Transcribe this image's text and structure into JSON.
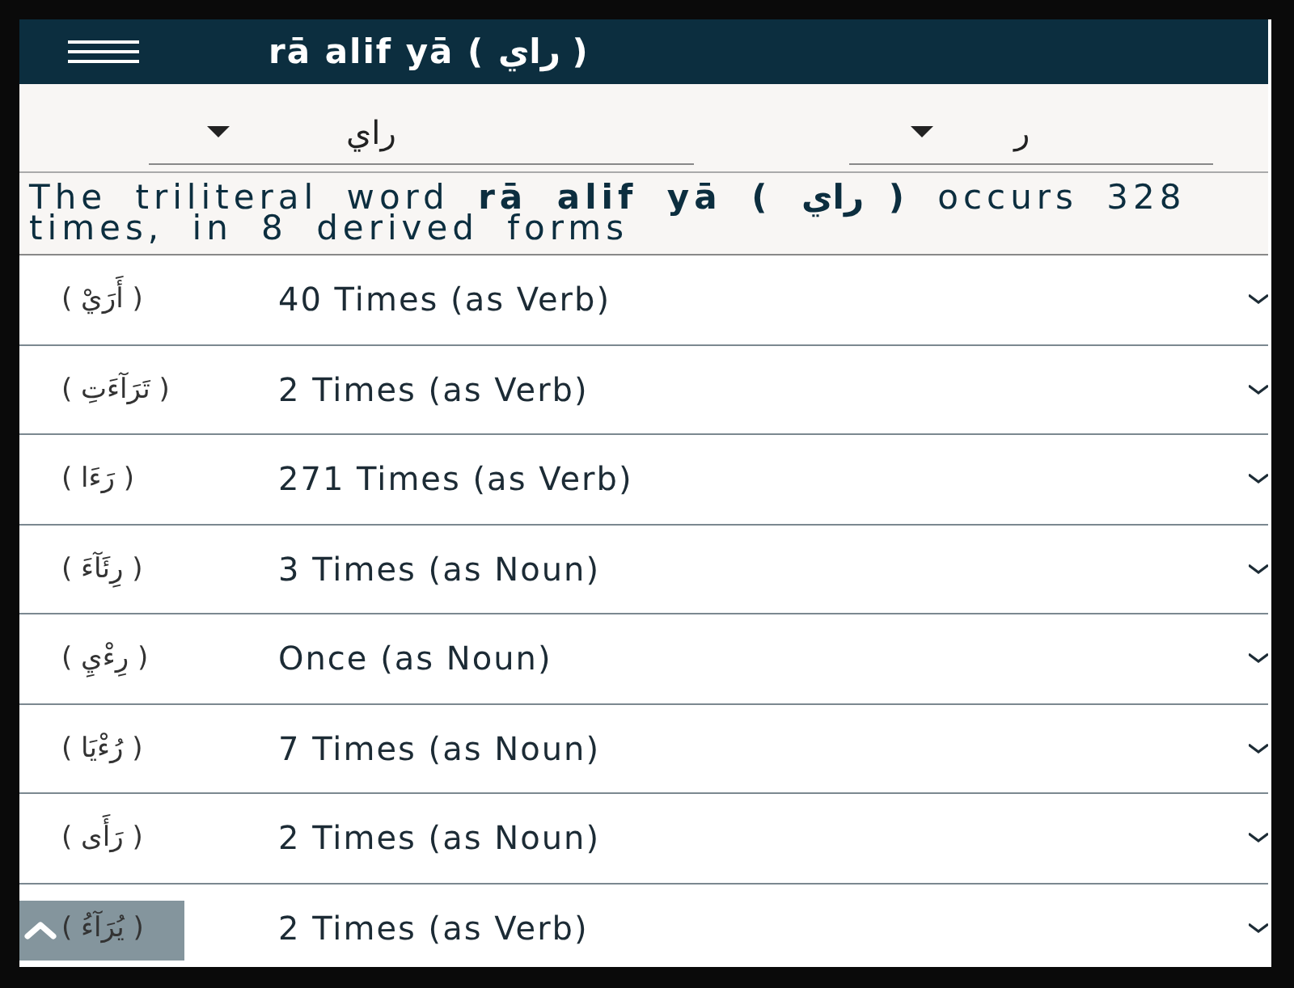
{
  "app_bar": {
    "title": "rā alif yā ( راي )"
  },
  "selectors": [
    {
      "value": "ر"
    },
    {
      "value": "راي"
    }
  ],
  "summary": "The triliteral word **rā alif yā ( راي )** occurs 328 times, in 8 derived forms",
  "forms": [
    {
      "arabic": "( أَرَيْ )",
      "count": "40 Times (as Verb)",
      "expanded": false
    },
    {
      "arabic": "( تَرَآءَتِ )",
      "count": "2 Times (as Verb)",
      "expanded": false
    },
    {
      "arabic": "( رَءَا )",
      "count": "271 Times (as Verb)",
      "expanded": false
    },
    {
      "arabic": "( رِئَآءَ )",
      "count": "3 Times (as Noun)",
      "expanded": false
    },
    {
      "arabic": "( رِءْيِ )",
      "count": "Once (as Noun)",
      "expanded": false
    },
    {
      "arabic": "( رُءْيَا )",
      "count": "7 Times (as Noun)",
      "expanded": false
    },
    {
      "arabic": "( رَأَى )",
      "count": "2 Times (as Noun)",
      "expanded": false
    },
    {
      "arabic": "( يُرَآءُ )",
      "count": "2 Times (as Verb)",
      "expanded": false
    }
  ]
}
